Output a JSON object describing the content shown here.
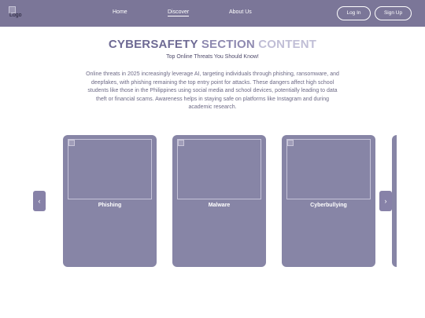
{
  "nav": {
    "logo_alt": "Logo",
    "links": [
      "Home",
      "Discover",
      "About Us"
    ],
    "login": "Log In",
    "signup": "Sign Up"
  },
  "header": {
    "title_part1": "CYBERSAFETY",
    "title_part2": "SECTION",
    "title_part3": "CONTENT",
    "subtitle": "Top Online Threats You Should Know!",
    "paragraph": "Online threats in 2025 increasingly leverage AI, targeting individuals through phishing, ransomware, and deepfakes, with phishing remaining the top entry point for attacks. These dangers affect high school students like those in the Philippines using social media and school devices, potentially leading to data theft or financial scams. Awareness helps in staying safe on platforms like Instagram and during academic research."
  },
  "carousel": {
    "prev": "‹",
    "next": "›",
    "cards": [
      "Phishing",
      "Malware",
      "Cyberbullying"
    ]
  },
  "colors": {
    "nav_bg": "#7b7698",
    "card_bg": "#8785a6",
    "title_accent": "#6e6a94"
  }
}
